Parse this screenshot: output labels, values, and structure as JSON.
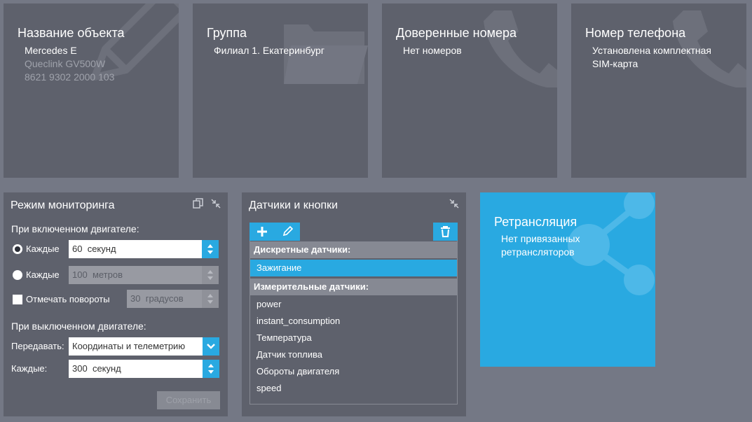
{
  "tiles": {
    "object_name": {
      "title": "Название объекта",
      "lines": [
        "Mercedes E",
        "Queclink GV500W",
        "8621 9302 2000 103"
      ]
    },
    "group": {
      "title": "Группа",
      "lines": [
        "Филиал 1. Екатеринбург"
      ]
    },
    "trusted_numbers": {
      "title": "Доверенные номера",
      "lines": [
        "Нет номеров"
      ]
    },
    "phone_number": {
      "title": "Номер телефона",
      "lines": [
        "Установлена комплектная",
        "SIM-карта"
      ]
    },
    "relay": {
      "title": "Ретрансляция",
      "lines": [
        "Нет привязанных",
        "ретрансляторов"
      ]
    }
  },
  "monitoring": {
    "title": "Режим мониторинга",
    "engine_on_label": "При включенном двигателе:",
    "every_time": {
      "label": "Каждые",
      "value": "60",
      "unit": "секунд",
      "selected": true
    },
    "every_distance": {
      "label": "Каждые",
      "value": "100",
      "unit": "метров",
      "selected": false
    },
    "mark_turns": {
      "label": "Отмечать повороты",
      "value": "30",
      "unit": "градусов",
      "checked": false
    },
    "engine_off_label": "При выключенном двигателе:",
    "transmit": {
      "label": "Передавать:",
      "value": "Координаты и телеметрию"
    },
    "every_off": {
      "label": "Каждые:",
      "value": "300",
      "unit": "секунд"
    },
    "save_label": "Сохранить"
  },
  "sensors": {
    "title": "Датчики и кнопки",
    "discrete_header": "Дискретные датчики:",
    "discrete": [
      "Зажигание"
    ],
    "measuring_header": "Измерительные датчики:",
    "measuring": [
      "power",
      "instant_consumption",
      "Температура",
      "Датчик топлива",
      "Обороты двигателя",
      "speed"
    ]
  },
  "colors": {
    "background": "#747885",
    "tile": "#5e616c",
    "accent": "#29a9e1",
    "relay_tile": "#29a9e1"
  },
  "icons": {
    "object_name": "pencil-icon",
    "group": "folder-icon",
    "trusted_numbers": "phone-icon",
    "phone_number": "phone-icon",
    "relay": "share-icon",
    "panel_controls": [
      "copy-icon",
      "collapse-icon"
    ],
    "toolbar": [
      "plus-icon",
      "edit-icon",
      "trash-icon"
    ]
  }
}
